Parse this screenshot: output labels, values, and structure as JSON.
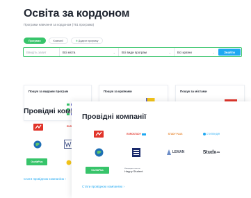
{
  "header": {
    "title": "Освіта за кордоном",
    "subtitle": "Програми навчання за кордоном (761 програма)"
  },
  "tabs": [
    {
      "label": "Програми",
      "active": true
    },
    {
      "label": "Компанії",
      "active": false
    },
    {
      "label": "Додати програму",
      "active": false,
      "icon": "plus-icon"
    }
  ],
  "search": {
    "placeholder": "Введіть запит",
    "city": "Всі міста",
    "programs": "Всі види програм",
    "countries": "Всі країни",
    "button": "Знайти"
  },
  "cards": [
    {
      "title": "Пошук за видами програм",
      "icon": "list-icon"
    },
    {
      "title": "Пошук за країнами",
      "icon": "flag-icon"
    },
    {
      "title": "Пошук за містами",
      "icon": "city-icon"
    }
  ],
  "background_section": {
    "heading": "Провідні компанії",
    "link": "Стати провідною компанією ›"
  },
  "modal": {
    "heading": "Провідні компанії",
    "link": "Стати провідною компанією ›",
    "logos": {
      "l1": "",
      "l2": "EUROSTUDY",
      "l3": "STUDY PLUS",
      "l4": "СТИПЕНДІЯ",
      "l5": "",
      "l6": "",
      "l7": "LEMAN",
      "l8": "Studx",
      "l8b": ".au",
      "l9": "OsvitaPlus",
      "l10a": "Міжнародне агентство",
      "l10b": "Happy Student"
    }
  },
  "colors": {
    "accent_green": "#37c46a",
    "accent_blue": "#1fa8f2",
    "logo_red": "#e1342a"
  }
}
